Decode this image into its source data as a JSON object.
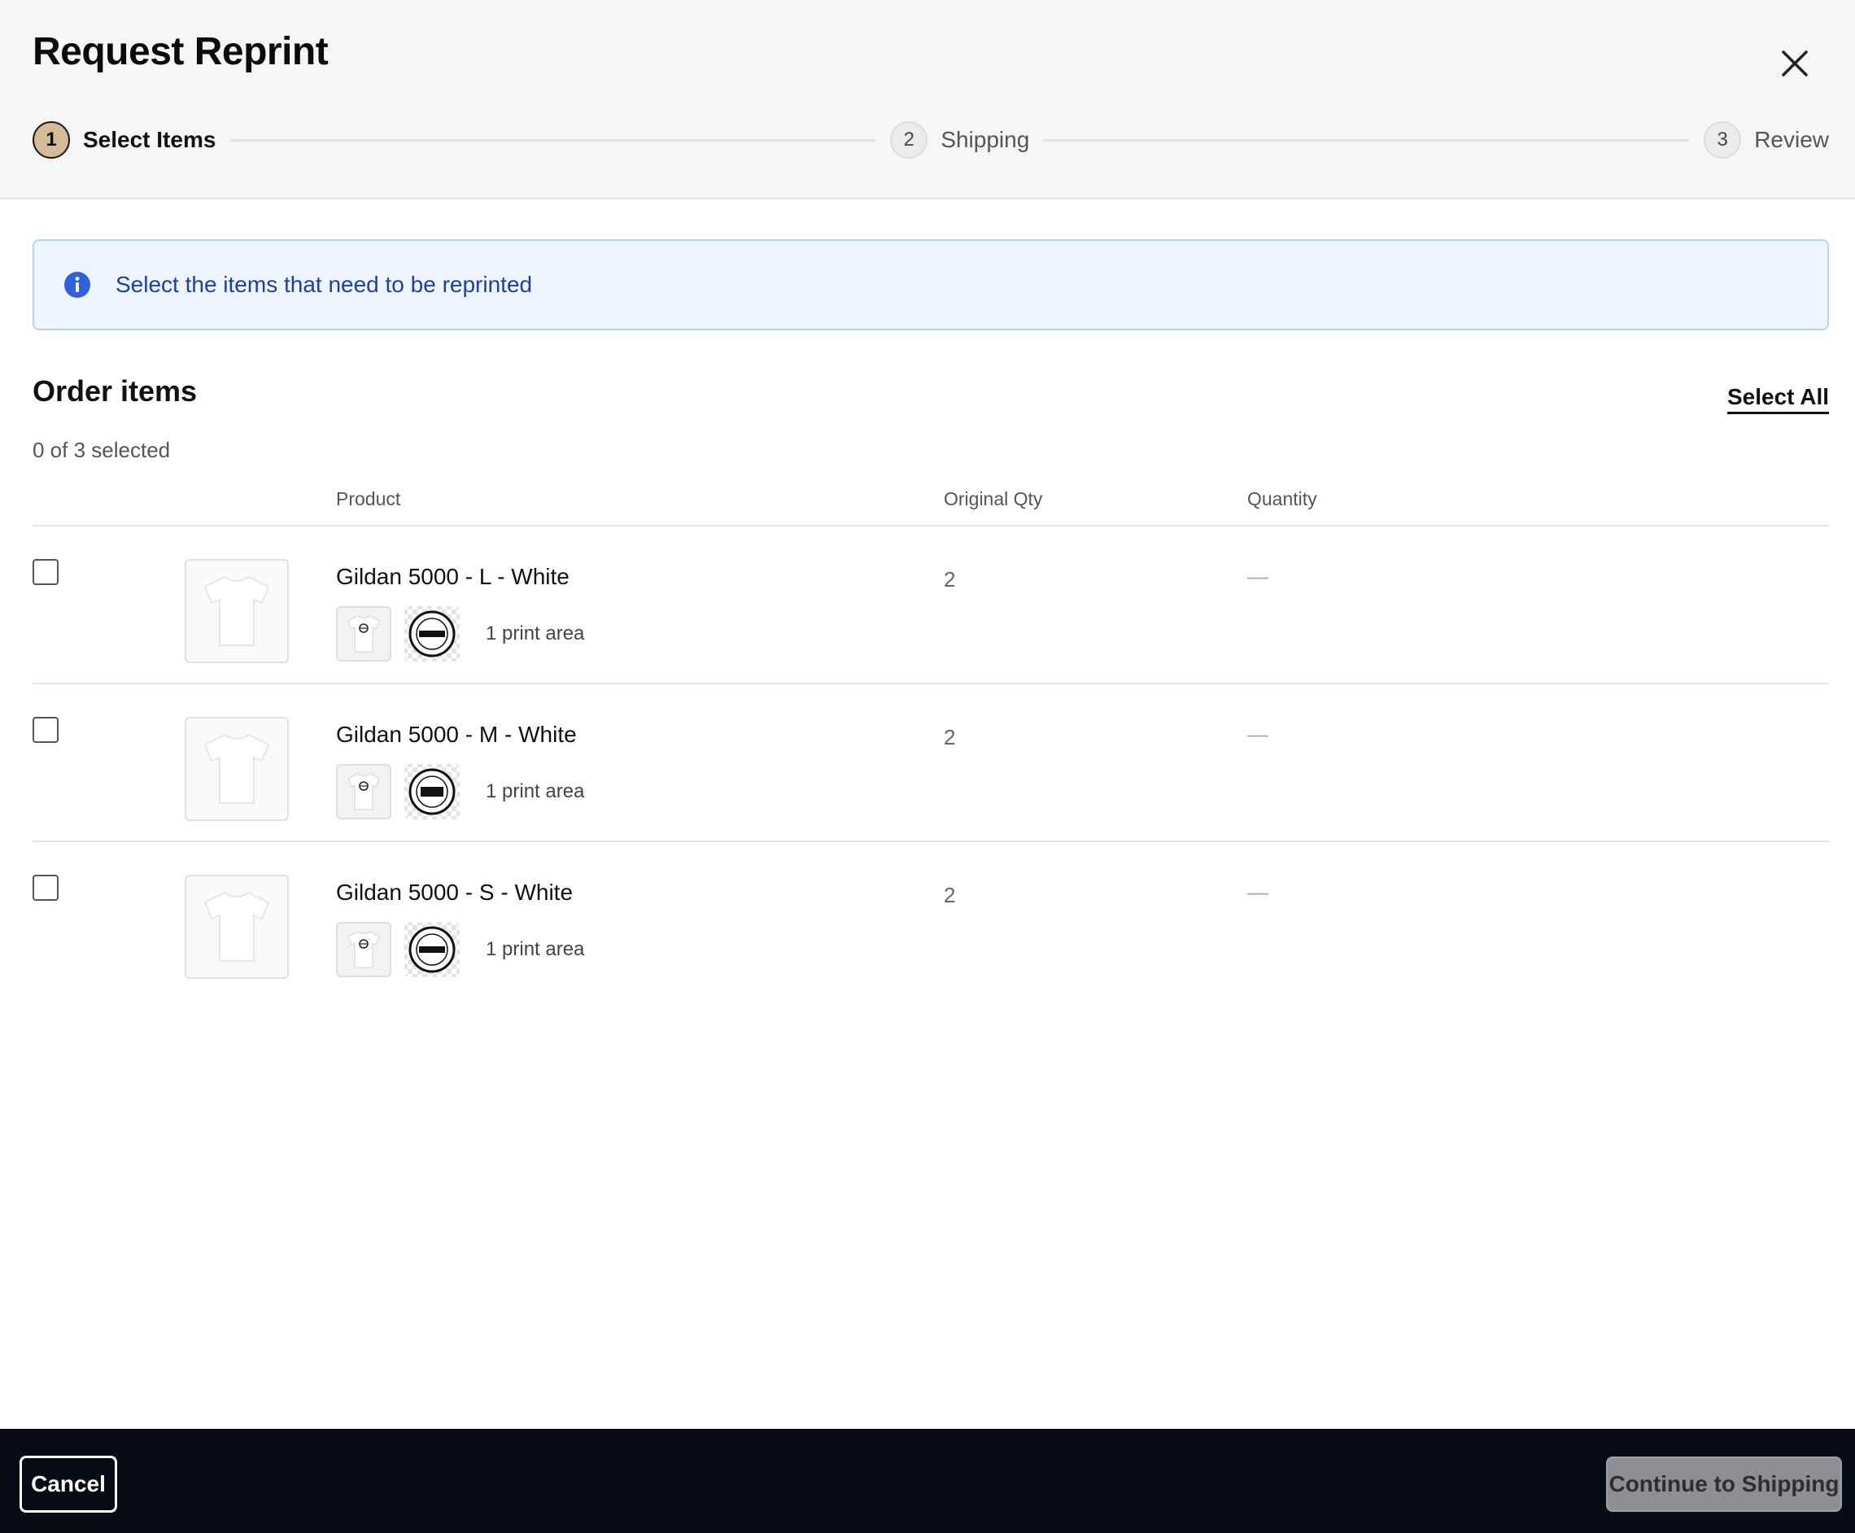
{
  "dialog": {
    "title": "Request Reprint"
  },
  "stepper": {
    "steps": [
      {
        "number": "1",
        "label": "Select Items",
        "active": true
      },
      {
        "number": "2",
        "label": "Shipping",
        "active": false
      },
      {
        "number": "3",
        "label": "Review",
        "active": false
      }
    ]
  },
  "banner": {
    "text": "Select the items that need to be reprinted",
    "icon": "info-icon"
  },
  "order_items": {
    "title": "Order items",
    "select_all_label": "Select All",
    "selected_count": "0 of 3 selected",
    "columns": {
      "product": "Product",
      "original_qty": "Original Qty",
      "quantity": "Quantity"
    },
    "rows": [
      {
        "name": "Gildan 5000 - L - White",
        "print_area": "1 print area",
        "original_qty": "2",
        "quantity": "—"
      },
      {
        "name": "Gildan 5000 - M - White",
        "print_area": "1 print area",
        "original_qty": "2",
        "quantity": "—"
      },
      {
        "name": "Gildan 5000 - S - White",
        "print_area": "1 print area",
        "original_qty": "2",
        "quantity": "—"
      }
    ]
  },
  "footer": {
    "cancel_label": "Cancel",
    "continue_label": "Continue to Shipping"
  },
  "colors": {
    "active_step": "#d5bb98",
    "banner_bg": "#eef5ff",
    "banner_text": "#1d3f9e",
    "footer_bg": "#060b14"
  }
}
